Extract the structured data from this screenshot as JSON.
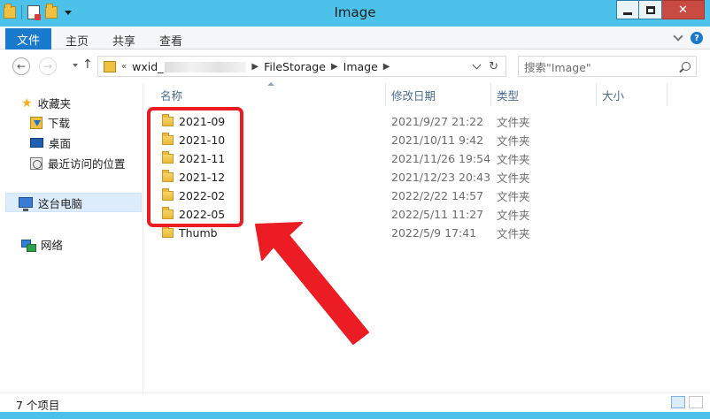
{
  "window": {
    "title": "Image",
    "close_label": "✕"
  },
  "ribbon": {
    "file_tab": "文件",
    "tabs": [
      "主页",
      "共享",
      "查看"
    ],
    "help": "?"
  },
  "address": {
    "prefix": "«",
    "crumbs": [
      "wxid_",
      "FileStorage",
      "Image"
    ]
  },
  "search": {
    "placeholder": "搜索\"Image\""
  },
  "nav_pane": {
    "favorites": "收藏夹",
    "items": [
      "下载",
      "桌面",
      "最近访问的位置"
    ],
    "this_pc": "这台电脑",
    "network": "网络"
  },
  "columns": {
    "name": "名称",
    "date": "修改日期",
    "type": "类型",
    "size": "大小"
  },
  "files": [
    {
      "name": "2021-09",
      "date": "2021/9/27 21:22",
      "type": "文件夹"
    },
    {
      "name": "2021-10",
      "date": "2021/10/11 9:42",
      "type": "文件夹"
    },
    {
      "name": "2021-11",
      "date": "2021/11/26 19:54",
      "type": "文件夹"
    },
    {
      "name": "2021-12",
      "date": "2021/12/23 20:43",
      "type": "文件夹"
    },
    {
      "name": "2022-02",
      "date": "2022/2/22 14:57",
      "type": "文件夹"
    },
    {
      "name": "2022-05",
      "date": "2022/5/11 11:27",
      "type": "文件夹"
    },
    {
      "name": "Thumb",
      "date": "2022/5/9 17:41",
      "type": "文件夹"
    }
  ],
  "status": {
    "count": "7 个项目"
  },
  "colors": {
    "titlebar": "#4cc2ea",
    "file_tab": "#1979ca",
    "annotation": "#ec1c24"
  }
}
